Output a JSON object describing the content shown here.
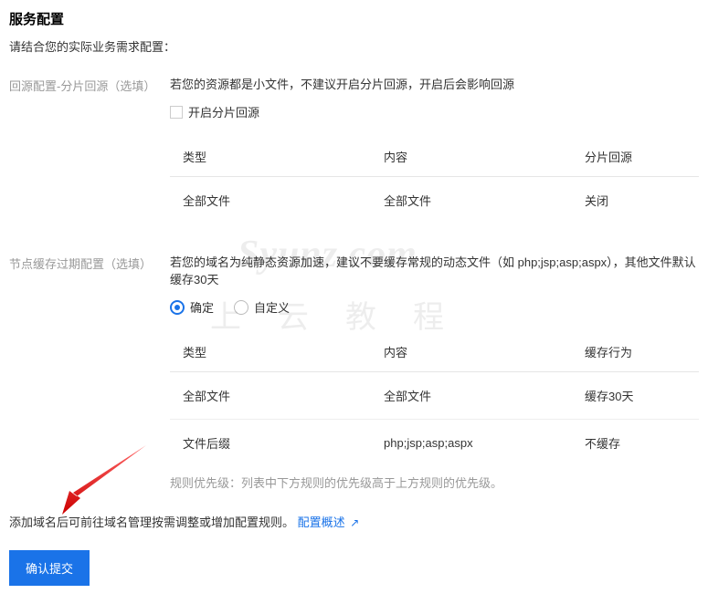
{
  "header": {
    "title": "服务配置",
    "subtitle": "请结合您的实际业务需求配置："
  },
  "section1": {
    "label": "回源配置-分片回源（选填）",
    "hint": "若您的资源都是小文件，不建议开启分片回源，开启后会影响回源",
    "checkbox_label": "开启分片回源",
    "table": {
      "th1": "类型",
      "th2": "内容",
      "th3": "分片回源",
      "rows": [
        {
          "c1": "全部文件",
          "c2": "全部文件",
          "c3": "关闭"
        }
      ]
    }
  },
  "section2": {
    "label": "节点缓存过期配置（选填）",
    "hint": "若您的域名为纯静态资源加速，建议不要缓存常规的动态文件（如 php;jsp;asp;aspx），其他文件默认缓存30天",
    "radio_fixed": "确定",
    "radio_custom": "自定义",
    "table": {
      "th1": "类型",
      "th2": "内容",
      "th3": "缓存行为",
      "rows": [
        {
          "c1": "全部文件",
          "c2": "全部文件",
          "c3": "缓存30天"
        },
        {
          "c1": "文件后缀",
          "c2": "php;jsp;asp;aspx",
          "c3": "不缓存"
        }
      ]
    },
    "priority_hint": "规则优先级：列表中下方规则的优先级高于上方规则的优先级。"
  },
  "footer": {
    "pre_link_text": "添加域名后可前往域名管理按需调整或增加配置规则。",
    "link_text": "配置概述",
    "submit_label": "确认提交"
  },
  "watermark": {
    "line1": "Syunz.com",
    "line2": "上云教程"
  }
}
